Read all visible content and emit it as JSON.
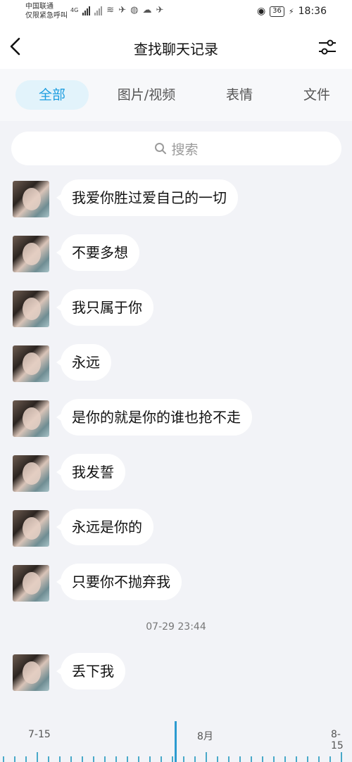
{
  "status_bar": {
    "carrier_line1": "中国联通",
    "carrier_line2": "仅限紧急呼叫",
    "network": "4G",
    "battery": "36",
    "time": "18:36"
  },
  "nav": {
    "title": "查找聊天记录"
  },
  "tabs": [
    {
      "label": "全部",
      "active": true
    },
    {
      "label": "图片/视频",
      "active": false
    },
    {
      "label": "表情",
      "active": false
    },
    {
      "label": "文件",
      "active": false
    }
  ],
  "search": {
    "placeholder": "搜索"
  },
  "messages": [
    {
      "text": "我爱你胜过爱自己的一切"
    },
    {
      "text": "不要多想"
    },
    {
      "text": "我只属于你"
    },
    {
      "text": "永远"
    },
    {
      "text": "是你的就是你的谁也抢不走"
    },
    {
      "text": "我发誓"
    },
    {
      "text": "永远是你的"
    },
    {
      "text": "只要你不抛弃我"
    }
  ],
  "timestamp": "07-29 23:44",
  "messages_after": [
    {
      "text": "丢下我"
    }
  ],
  "timeline": {
    "labels": [
      "7-15",
      "8月",
      "8-15"
    ],
    "accent": "#2c9bd0"
  },
  "colors": {
    "accent": "#1e9ee0",
    "tab_active_bg": "#e2f3fb",
    "page_bg": "#f2f3f7"
  }
}
